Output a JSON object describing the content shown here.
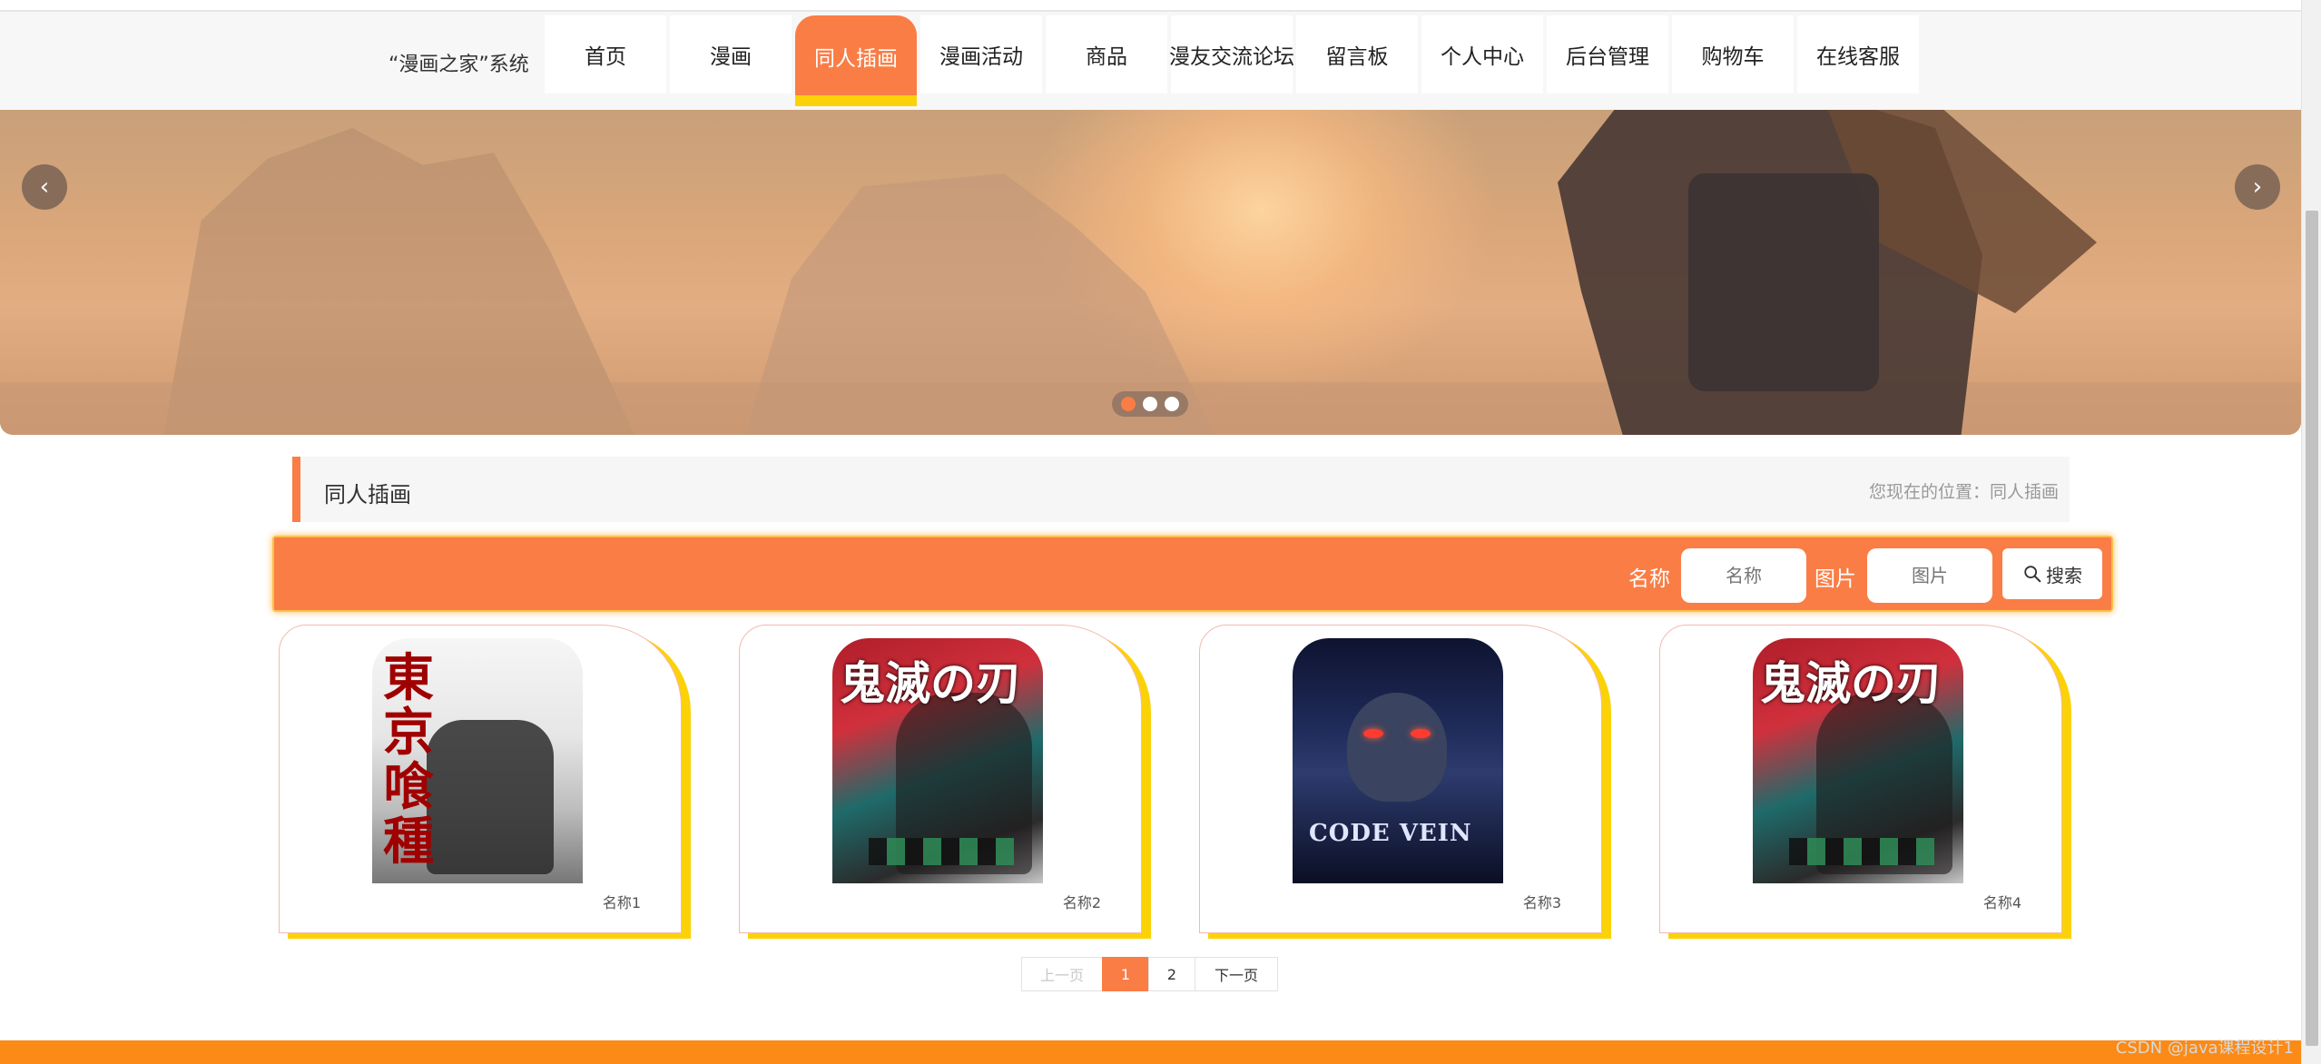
{
  "header": {
    "site_title": "“漫画之家”系统",
    "nav": [
      {
        "label": "首页",
        "active": false
      },
      {
        "label": "漫画",
        "active": false
      },
      {
        "label": "同人插画",
        "active": true
      },
      {
        "label": "漫画活动",
        "active": false
      },
      {
        "label": "商品",
        "active": false
      },
      {
        "label": "漫友交流论坛",
        "active": false
      },
      {
        "label": "留言板",
        "active": false
      },
      {
        "label": "个人中心",
        "active": false
      },
      {
        "label": "后台管理",
        "active": false
      },
      {
        "label": "购物车",
        "active": false
      },
      {
        "label": "在线客服",
        "active": false
      }
    ]
  },
  "banner": {
    "prev_icon": "chevron-left-icon",
    "next_icon": "chevron-right-icon",
    "slides": 3,
    "active_slide": 1
  },
  "section": {
    "title": "同人插画",
    "breadcrumb": "您现在的位置：同人插画"
  },
  "search": {
    "name_label": "名称",
    "name_placeholder": "名称",
    "image_label": "图片",
    "image_placeholder": "图片",
    "button_label": "搜索",
    "button_icon": "search-icon"
  },
  "cards": [
    {
      "name": "名称1",
      "cover_title": "東京喰種"
    },
    {
      "name": "名称2",
      "cover_title": "鬼滅の刃"
    },
    {
      "name": "名称3",
      "cover_title": "CODE VEIN"
    },
    {
      "name": "名称4",
      "cover_title": "鬼滅の刃"
    }
  ],
  "pagination": {
    "prev": "上一页",
    "pages": [
      "1",
      "2"
    ],
    "current": "1",
    "next": "下一页"
  },
  "watermark": "CSDN @java课程设计1",
  "colors": {
    "accent": "#fa7d45",
    "highlight": "#fbd207",
    "footer": "#fb8a16"
  }
}
